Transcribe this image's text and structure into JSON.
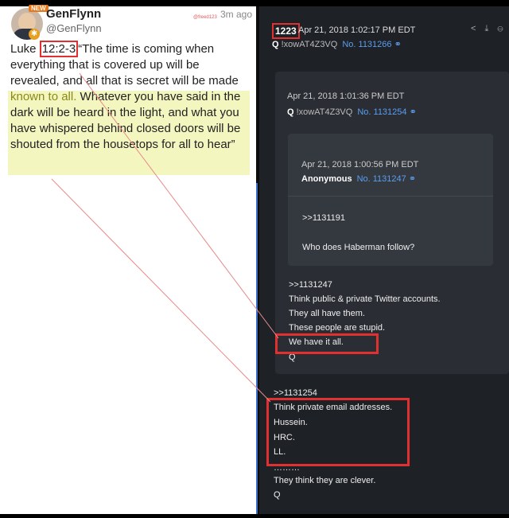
{
  "tweet": {
    "new_badge": "NEW",
    "display_name": "GenFlynn",
    "handle": "@GenFlynn",
    "tag": "@freed123",
    "time_ago": "3m ago",
    "text_prefix": "Luke ",
    "verse_ref": "12:2-3",
    "text_part1": "“The time is coming when everything that is covered up will be revealed, and all that is secret will be made ",
    "text_known": "known to all.",
    "text_part2": " Whatever you have said in the dark will be heard in the light, and what you have whispered behind closed doors will be shouted from the housetops for all to hear”"
  },
  "q_post": {
    "number": "1223",
    "date": "Apr 21, 2018 1:02:17 PM EDT",
    "author": "Q",
    "trip": "!xowAT4Z3VQ",
    "post_no": "No. 1131266",
    "quoted": {
      "date": "Apr 21, 2018 1:01:36 PM EDT",
      "author": "Q",
      "trip": "!xowAT4Z3VQ",
      "post_no": "No. 1131254",
      "inner": {
        "date": "Apr 21, 2018 1:00:56 PM EDT",
        "author": "Anonymous",
        "post_no": "No. 1131247",
        "ref": ">>1131191",
        "text": "Who does Haberman follow?"
      },
      "ref": ">>1131247",
      "lines": [
        "Think public & private Twitter accounts.",
        "They all have them.",
        "These people are stupid.",
        "We have it all.",
        "Q"
      ]
    },
    "ref": ">>1131254",
    "lines": [
      "Think private email addresses.",
      "Hussein.",
      "HRC.",
      "LL.",
      "………",
      "They think they are clever.",
      "Q"
    ]
  }
}
